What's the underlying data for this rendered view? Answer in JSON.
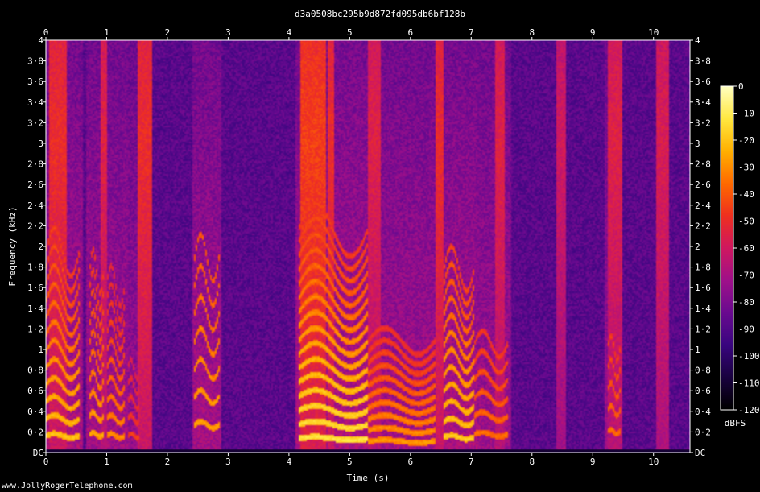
{
  "footer_text": "www.JollyRogerTelephone.com",
  "colors": {
    "background": "#000000",
    "text": "#ffffff",
    "axis": "#ffffff"
  },
  "chart_data": {
    "type": "heatmap",
    "title": "d3a0508bc295b9d872fd095db6bf128b",
    "xlabel": "Time (s)",
    "ylabel": "Frequency (kHz)",
    "colorbar_label": "dBFS",
    "xlim": [
      0,
      10.6
    ],
    "ylim": [
      0,
      4
    ],
    "zlim": [
      -120,
      0
    ],
    "x_ticks": [
      0,
      1,
      2,
      3,
      4,
      5,
      6,
      7,
      8,
      9,
      10
    ],
    "x_tick_labels": [
      "0",
      "1",
      "2",
      "3",
      "4",
      "5",
      "6",
      "7",
      "8",
      "9",
      "10"
    ],
    "y_ticks": [
      0,
      0.2,
      0.4,
      0.6,
      0.8,
      1,
      1.2,
      1.4,
      1.6,
      1.8,
      2,
      2.2,
      2.4,
      2.6,
      2.8,
      3,
      3.2,
      3.4,
      3.6,
      3.8,
      4
    ],
    "y_tick_labels": [
      "DC",
      "0·2",
      "0·4",
      "0·6",
      "0·8",
      "1",
      "1·2",
      "1·4",
      "1·6",
      "1·8",
      "2",
      "2·2",
      "2·4",
      "2·6",
      "2·8",
      "3",
      "3·2",
      "3·4",
      "3·6",
      "3·8",
      "4"
    ],
    "colorbar_ticks": [
      0,
      -10,
      -20,
      -30,
      -40,
      -50,
      -60,
      -70,
      -80,
      -90,
      -100,
      -110,
      -120
    ],
    "colormap": [
      "#000000",
      "#1a0240",
      "#3a0680",
      "#6a0a90",
      "#a0108a",
      "#d01860",
      "#f03020",
      "#ff6a00",
      "#ffb000",
      "#ffe840",
      "#ffffc0"
    ],
    "voiced_segments": [
      {
        "start": 0.0,
        "end": 0.55,
        "f0_khz": 0.12,
        "harmonics": 12,
        "level_db": -20
      },
      {
        "start": 0.72,
        "end": 0.95,
        "f0_khz": 0.13,
        "harmonics": 10,
        "level_db": -25
      },
      {
        "start": 1.0,
        "end": 1.3,
        "f0_khz": 0.12,
        "harmonics": 10,
        "level_db": -30
      },
      {
        "start": 1.35,
        "end": 1.55,
        "f0_khz": 0.12,
        "harmonics": 5,
        "level_db": -45
      },
      {
        "start": 2.45,
        "end": 2.85,
        "f0_khz": 0.2,
        "harmonics": 7,
        "level_db": -25
      },
      {
        "start": 4.15,
        "end": 5.3,
        "f0_khz": 0.1,
        "harmonics": 16,
        "level_db": -12
      },
      {
        "start": 5.3,
        "end": 6.4,
        "f0_khz": 0.08,
        "harmonics": 10,
        "level_db": -28
      },
      {
        "start": 6.55,
        "end": 7.05,
        "f0_khz": 0.11,
        "harmonics": 12,
        "level_db": -18
      },
      {
        "start": 7.05,
        "end": 7.6,
        "f0_khz": 0.13,
        "harmonics": 6,
        "level_db": -35
      },
      {
        "start": 9.25,
        "end": 9.45,
        "f0_khz": 0.15,
        "harmonics": 5,
        "level_db": -35
      }
    ],
    "noise_bursts": [
      {
        "start": 0.05,
        "end": 0.35,
        "level_db": -55
      },
      {
        "start": 0.9,
        "end": 1.0,
        "level_db": -60
      },
      {
        "start": 1.5,
        "end": 1.75,
        "level_db": -55
      },
      {
        "start": 4.2,
        "end": 4.6,
        "level_db": -50
      },
      {
        "start": 4.65,
        "end": 4.75,
        "level_db": -55
      },
      {
        "start": 5.3,
        "end": 5.5,
        "level_db": -60
      },
      {
        "start": 6.4,
        "end": 6.55,
        "level_db": -55
      },
      {
        "start": 7.4,
        "end": 7.55,
        "level_db": -60
      },
      {
        "start": 8.4,
        "end": 8.55,
        "level_db": -65
      },
      {
        "start": 9.25,
        "end": 9.5,
        "level_db": -60
      },
      {
        "start": 10.05,
        "end": 10.25,
        "level_db": -62
      }
    ]
  }
}
